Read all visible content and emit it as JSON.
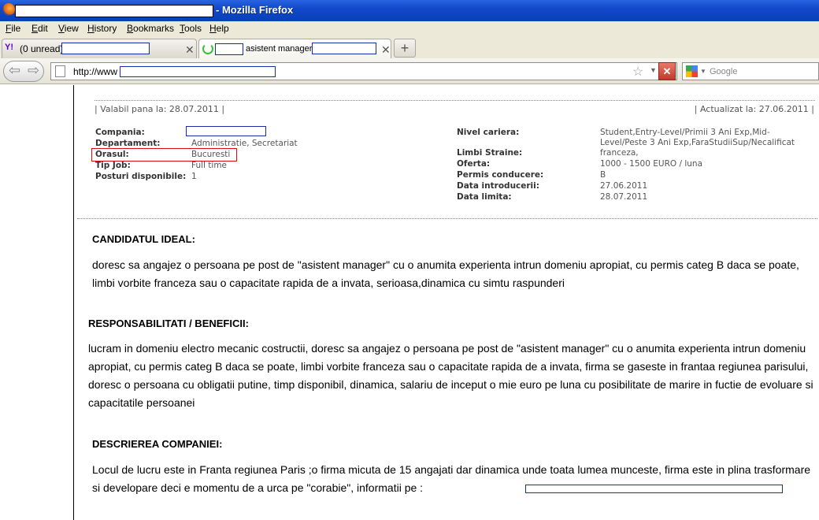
{
  "window": {
    "title": "- Mozilla Firefox"
  },
  "menu": [
    "File",
    "Edit",
    "View",
    "History",
    "Bookmarks",
    "Tools",
    "Help"
  ],
  "tabs": [
    {
      "label": "(0 unread)"
    },
    {
      "label": "asistent manager"
    }
  ],
  "toolbar": {
    "url_prefix": "http://www",
    "search_placeholder": "Google",
    "new_tab": "+"
  },
  "job": {
    "valid_until": "| Valabil pana la: 28.07.2011 |",
    "updated": "| Actualizat la: 27.06.2011 |",
    "left_fields": [
      {
        "label": "Compania:",
        "value": ""
      },
      {
        "label": "Departament:",
        "value": "Administratie, Secretariat"
      },
      {
        "label": "Orasul:",
        "value": "Bucuresti"
      },
      {
        "label": "Tip Job:",
        "value": "Full time"
      },
      {
        "label": "Posturi disponibile:",
        "value": "1"
      }
    ],
    "right_fields": [
      {
        "label": "Nivel cariera:",
        "value": "Student,Entry-Level/Primii 3 Ani Exp,Mid-Level/Peste 3 Ani Exp,FaraStudiiSup/Necalificat"
      },
      {
        "label": "Limbi Straine:",
        "value": "franceza,"
      },
      {
        "label": "Oferta:",
        "value": "1000 - 1500 EURO / luna"
      },
      {
        "label": "Permis conducere:",
        "value": "B"
      },
      {
        "label": "Data introducerii:",
        "value": "27.06.2011"
      },
      {
        "label": "Data limita:",
        "value": "28.07.2011"
      }
    ]
  },
  "sections": {
    "ideal_title": "CANDIDATUL IDEAL:",
    "ideal_text": "doresc sa angajez o persoana pe post de \"asistent manager\" cu o anumita experienta intrun domeniu apropiat, cu permis categ B daca se poate, limbi vorbite franceza sau o capacitate rapida de a invata, serioasa,dinamica cu simtu raspunderi",
    "resp_title": "RESPONSABILITATI / BENEFICII:",
    "resp_text": "lucram in domeniu electro mecanic costructii, doresc sa angajez o persoana pe post de \"asistent manager\" cu o anumita experienta intrun domeniu apropiat, cu permis categ B daca se poate, limbi vorbite franceza sau o capacitate rapida de a invata, firma se gaseste in frantaa regiunea parisului, doresc o persoana cu obligatii putine, timp disponibil, dinamica, salariu de inceput o mie euro pe luna cu posibilitate de marire in fuctie de evoluare si capacitatile persoanei",
    "company_title": "DESCRIEREA COMPANIEI:",
    "company_text": "Locul de lucru este in Franta regiunea Paris ;o firma micuta de 15 angajati dar dinamica unde toata lumea munceste, firma este in plina trasformare si developare deci e momentu de a urca pe \"corabie\", informatii pe :"
  }
}
